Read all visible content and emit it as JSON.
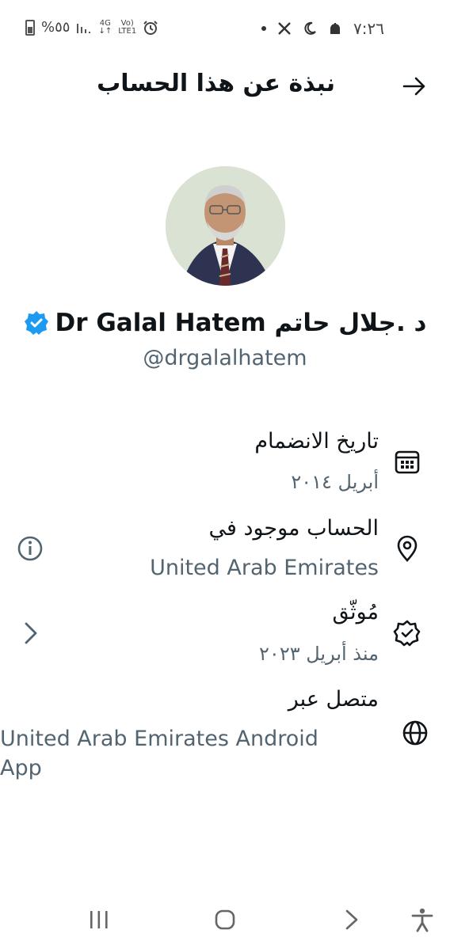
{
  "status_bar": {
    "battery_text": "%٥٥",
    "network_top": "4G",
    "volte_top": "Vo)",
    "volte_bottom": "LTE1",
    "time": "٧:٢٦"
  },
  "header": {
    "title": "نبذة عن هذا الحساب"
  },
  "profile": {
    "name": "د .جلال حاتم Dr Galal Hatem",
    "handle": "@drgalalhatem"
  },
  "info": {
    "joined_title": "تاريخ الانضمام",
    "joined_value": "أبريل ٢٠١٤",
    "location_title": "الحساب موجود في",
    "location_value": "United Arab Emirates",
    "verified_title": "مُوثّق",
    "verified_value": "منذ أبريل ٢٠٢٣",
    "connected_title": "متصل عبر",
    "connected_value_line1": "United Arab Emirates Android",
    "connected_value_line2": "App"
  },
  "colors": {
    "accent": "#1d9bf0",
    "text": "#0f1419",
    "secondary": "#536471"
  }
}
